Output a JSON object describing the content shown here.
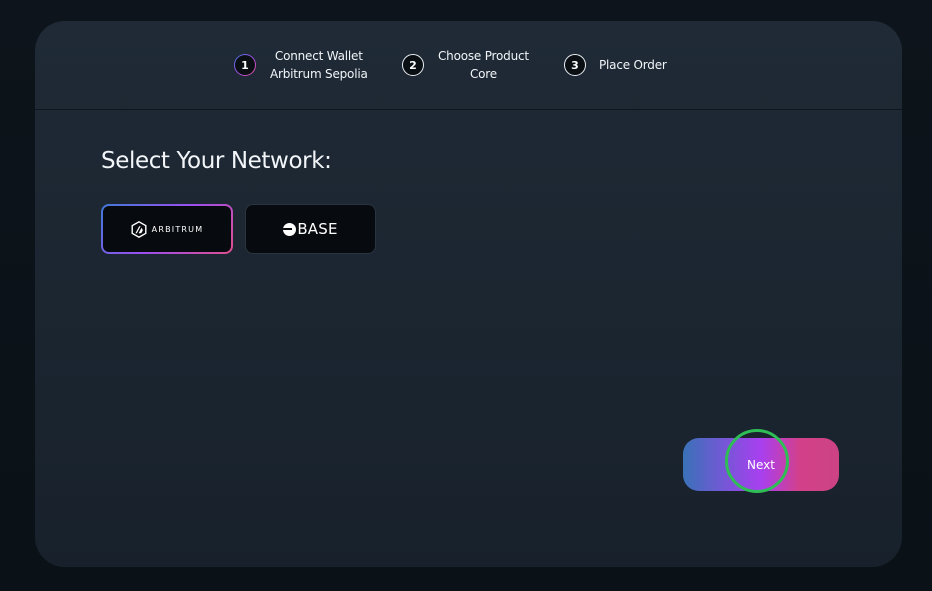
{
  "stepper": {
    "steps": [
      {
        "number": "1",
        "line1": "Connect Wallet",
        "line2": "Arbitrum Sepolia"
      },
      {
        "number": "2",
        "line1": "Choose Product",
        "line2": "Core"
      },
      {
        "number": "3",
        "line1": "Place Order",
        "line2": ""
      }
    ]
  },
  "main": {
    "title": "Select Your Network:",
    "networks": [
      {
        "label": "ARBITRUM",
        "icon": "arbitrum-logo-icon",
        "selected": true
      },
      {
        "label": "BASE",
        "icon": "base-logo-icon",
        "selected": false
      }
    ],
    "next_label": "Next"
  },
  "colors": {
    "accent_blue": "#3a72b8",
    "accent_purple": "#a93ff0",
    "accent_pink": "#d3408a",
    "click_indicator": "#2fbd55"
  }
}
